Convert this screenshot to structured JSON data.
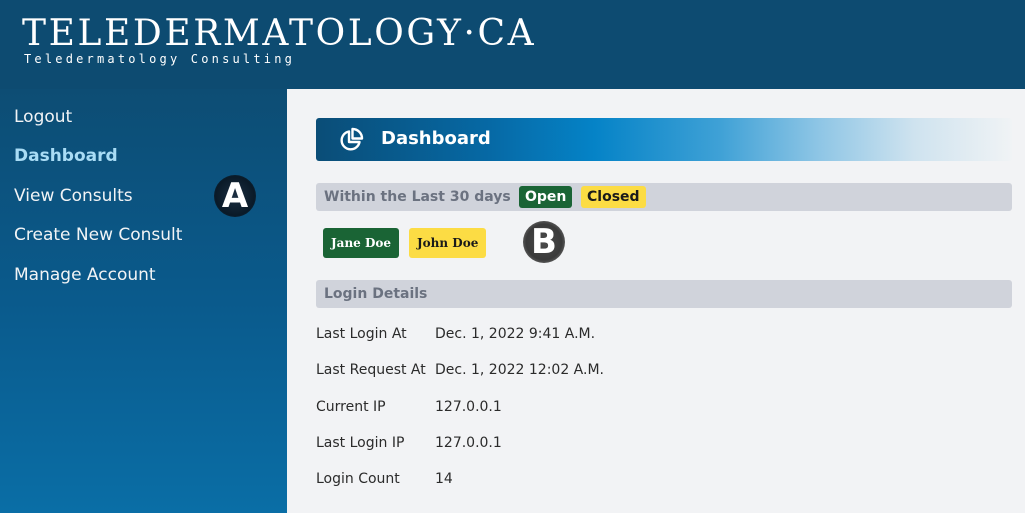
{
  "header": {
    "logo_title": "TELEDERMATOLOGY·CA",
    "logo_subtitle": "Teledermatology Consulting"
  },
  "sidebar": {
    "items": [
      {
        "label": "Logout",
        "active": false
      },
      {
        "label": "Dashboard",
        "active": true
      },
      {
        "label": "View Consults",
        "active": false
      },
      {
        "label": "Create New Consult",
        "active": false
      },
      {
        "label": "Manage Account",
        "active": false
      }
    ]
  },
  "markers": {
    "a": "A",
    "b": "B"
  },
  "main": {
    "title": "Dashboard",
    "title_icon": "pie-chart-icon",
    "summary": {
      "label": "Within the Last 30 days",
      "open_badge": "Open",
      "closed_badge": "Closed",
      "consults": [
        {
          "name": "Jane Doe",
          "status": "open"
        },
        {
          "name": "John Doe",
          "status": "closed"
        }
      ]
    },
    "login_details": {
      "heading": "Login Details",
      "rows": [
        {
          "label": "Last Login At",
          "value": "Dec. 1, 2022 9:41 A.M."
        },
        {
          "label": "Last Request At",
          "value": "Dec. 1, 2022 12:02 A.M."
        },
        {
          "label": "Current IP",
          "value": "127.0.0.1"
        },
        {
          "label": "Last Login IP",
          "value": "127.0.0.1"
        },
        {
          "label": "Login Count",
          "value": "14"
        }
      ]
    }
  },
  "colors": {
    "header_bg": "#0d4b71",
    "open_green": "#1a6435",
    "closed_yellow": "#fcdc44",
    "active_nav": "#a9dcf5",
    "section_bar": "#d0d3db",
    "content_bg": "#f2f3f5"
  }
}
